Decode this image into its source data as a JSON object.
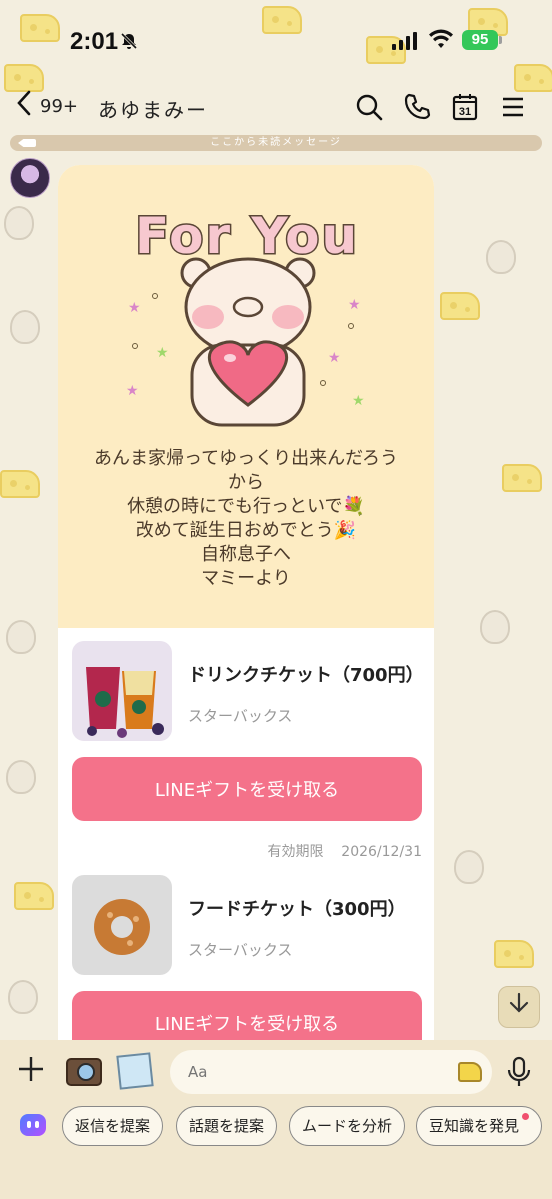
{
  "status_bar": {
    "time": "2:01",
    "battery": "95",
    "battery_color": "#34c759"
  },
  "header": {
    "unread_count": "99+",
    "chat_name": "あゆまみー",
    "icons": [
      "search-icon",
      "phone-icon",
      "calendar-icon",
      "menu-icon"
    ],
    "calendar_day": "31"
  },
  "divider_label": "ここから未読メッセージ",
  "gift_card": {
    "banner": "For You",
    "message_lines": [
      "あんま家帰ってゆっくり出来んだろう",
      "から",
      "休憩の時にでも行っといで💐",
      "改めて誕生日おめでとう🎉",
      "自称息子へ",
      "マミーより"
    ],
    "items": [
      {
        "name": "ドリンクチケット（700円）",
        "shop": "スターバックス",
        "button": "LINEギフトを受け取る"
      },
      {
        "name": "フードチケット（300円）",
        "shop": "スターバックス",
        "button": "LINEギフトを受け取る"
      }
    ],
    "expiry_label": "有効期限",
    "expiry_date": "2026/12/31"
  },
  "input": {
    "placeholder": "Aa"
  },
  "suggestions": [
    "返信を提案",
    "話題を提案",
    "ムードを分析",
    "豆知識を発見"
  ],
  "colors": {
    "gift_button": "#f4728a",
    "card_top": "#fdecc3",
    "background": "#f3eedf"
  }
}
